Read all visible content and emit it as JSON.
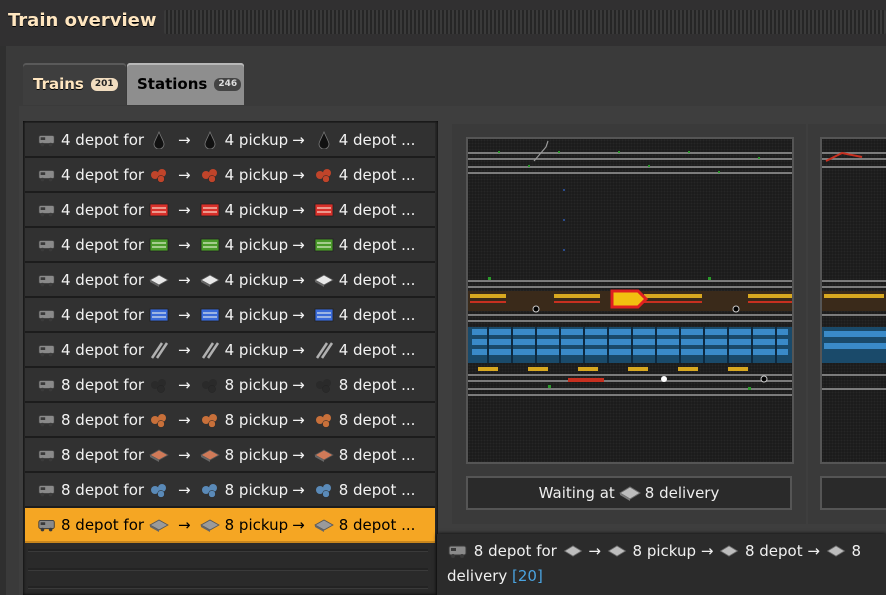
{
  "window": {
    "title": "Train overview"
  },
  "tabs": [
    {
      "label": "Trains",
      "count": "201"
    },
    {
      "label": "Stations",
      "count": "246"
    }
  ],
  "trains": [
    {
      "text1": "4 depot for",
      "text2": "4 pickup",
      "text3": "4 depot ...",
      "item_icon": "crude-oil-icon",
      "color": "#1a1a1a"
    },
    {
      "text1": "4 depot for",
      "text2": "4 pickup",
      "text3": "4 depot ...",
      "item_icon": "heavy-oil-icon",
      "color": "#c0442a"
    },
    {
      "text1": "4 depot for",
      "text2": "4 pickup",
      "text3": "4 depot ...",
      "item_icon": "red-circuit-icon",
      "color": "#d8302a"
    },
    {
      "text1": "4 depot for",
      "text2": "4 pickup",
      "text3": "4 depot ...",
      "item_icon": "green-circuit-icon",
      "color": "#4a9a2a"
    },
    {
      "text1": "4 depot for",
      "text2": "4 pickup",
      "text3": "4 depot ...",
      "item_icon": "plastic-bar-icon",
      "color": "#e8e8e8"
    },
    {
      "text1": "4 depot for",
      "text2": "4 pickup",
      "text3": "4 depot ...",
      "item_icon": "blue-circuit-icon",
      "color": "#3a6ad8"
    },
    {
      "text1": "4 depot for",
      "text2": "4 pickup",
      "text3": "4 depot ...",
      "item_icon": "steel-rail-icon",
      "color": "#b0b0b0"
    },
    {
      "text1": "8 depot for",
      "text2": "8 pickup",
      "text3": "8 depot ...",
      "item_icon": "coal-icon",
      "color": "#2a2a2a"
    },
    {
      "text1": "8 depot for",
      "text2": "8 pickup",
      "text3": "8 depot ...",
      "item_icon": "copper-ore-icon",
      "color": "#c8703a"
    },
    {
      "text1": "8 depot for",
      "text2": "8 pickup",
      "text3": "8 depot ...",
      "item_icon": "copper-plate-icon",
      "color": "#d07a58"
    },
    {
      "text1": "8 depot for",
      "text2": "8 pickup",
      "text3": "8 depot ...",
      "item_icon": "iron-ore-icon",
      "color": "#5a8ab8"
    },
    {
      "text1": "8 depot for",
      "text2": "8 pickup",
      "text3": "8 depot ...",
      "item_icon": "iron-plate-icon",
      "color": "#9a9a9a",
      "selected": true
    }
  ],
  "arrow": "→",
  "panels": [
    {
      "status_prefix": "Waiting at",
      "status_station": "8 delivery",
      "station_icon": "iron-plate-icon"
    }
  ],
  "tooltip": {
    "line1": "8 depot for",
    "line2": "8 pickup",
    "line3": "8 depot",
    "line4": "8",
    "line5": "delivery",
    "count": "[20]",
    "arrow": "→"
  },
  "colors": {
    "accent": "#f5a623",
    "title": "#ffe6c0",
    "count_blue": "#4aa3df"
  }
}
